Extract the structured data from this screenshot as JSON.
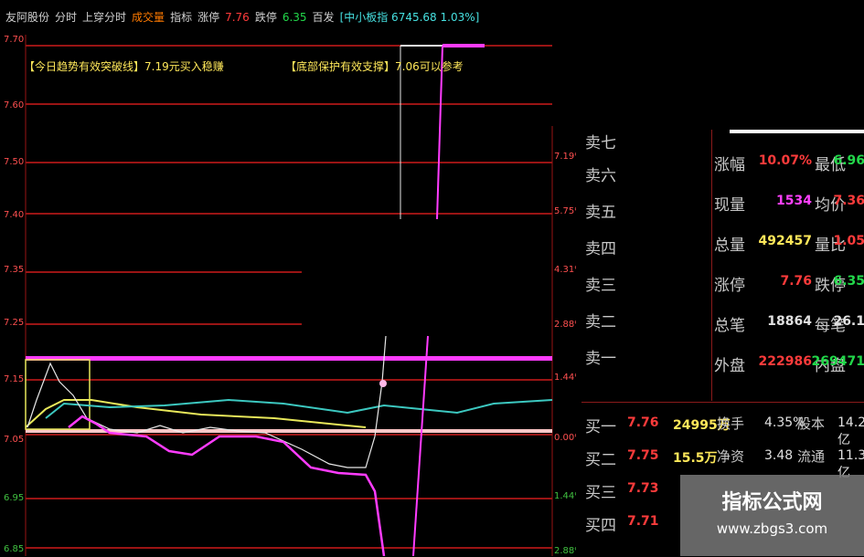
{
  "topbar": {
    "items": [
      {
        "text": "友阿股份",
        "color": "#d0d0d0"
      },
      {
        "text": "分时",
        "color": "#d0d0d0"
      },
      {
        "text": "上穿分时",
        "color": "#d0d0d0"
      },
      {
        "text": "成交量",
        "color": "#ff7a00"
      },
      {
        "text": "指标",
        "color": "#d0d0d0"
      },
      {
        "text": "涨停",
        "color": "#d0d0d0"
      },
      {
        "text": "7.76",
        "color": "#ff3b3b"
      },
      {
        "text": "跌停",
        "color": "#d0d0d0"
      },
      {
        "text": "6.35",
        "color": "#22d84a"
      },
      {
        "text": "百发",
        "color": "#d0d0d0"
      },
      {
        "text": "[中小板指 6745.68 1.03%]",
        "color": "#46e0e0"
      }
    ]
  },
  "chart": {
    "left_ticks": [
      "7.70",
      "7.60",
      "7.50",
      "7.40",
      "7.35",
      "7.25",
      "7.15",
      "7.05",
      "6.95",
      "6.85"
    ],
    "right_ticks": [
      "7.19%",
      "5.75%",
      "4.31%",
      "2.88%",
      "1.44%",
      "0.00%",
      "1.44%",
      "2.88%"
    ],
    "annotation_left": "【今日趋势有效突破线】7.19元买入稳赚",
    "annotation_right": "【底部保护有效支撑】7.06可以参考",
    "colors": {
      "grid": "#9a1414",
      "magenta": "#ff3cff",
      "yellow": "#e8e85a",
      "cyan": "#3cc8c0",
      "white": "#e8e8e8",
      "pink": "#ffc8c8"
    }
  },
  "quote_list": [
    "卖七",
    "卖六",
    "卖五",
    "卖四",
    "卖三",
    "卖二",
    "卖一"
  ],
  "stats": [
    {
      "l1": "涨幅",
      "v1": "10.07%",
      "c1": "#ff3b3b",
      "l2": "最低",
      "v2": "6.96",
      "c2": "#22d84a"
    },
    {
      "l1": "现量",
      "v1": "1534",
      "c1": "#ff40ff",
      "l2": "均价",
      "v2": "7.36",
      "c2": "#ff3b3b"
    },
    {
      "l1": "总量",
      "v1": "492457",
      "c1": "#ffe85a",
      "l2": "量比",
      "v2": "1.05",
      "c2": "#ff3b3b"
    },
    {
      "l1": "涨停",
      "v1": "7.76",
      "c1": "#ff3b3b",
      "l2": "跌停",
      "v2": "6.35",
      "c2": "#22d84a"
    },
    {
      "l1": "总笔",
      "v1": "18864",
      "c1": "#e0e0e0",
      "l2": "每笔",
      "v2": "26.1",
      "c2": "#e0e0e0"
    },
    {
      "l1": "外盘",
      "v1": "222986",
      "c1": "#ff3b3b",
      "l2": "内盘",
      "v2": "269471",
      "c2": "#22d84a"
    }
  ],
  "buy": [
    {
      "label": "买一",
      "price": "7.76",
      "vol": "24995万",
      "rl": "换手",
      "rv": "4.35%",
      "rl2": "股本",
      "rv2": "14.2亿"
    },
    {
      "label": "买二",
      "price": "7.75",
      "vol": "15.5万",
      "rl": "净资",
      "rv": "3.48",
      "rl2": "流通",
      "rv2": "11.3亿"
    },
    {
      "label": "买三",
      "price": "7.73",
      "vol": "",
      "rl": "",
      "rv": "",
      "rl2": "",
      "rv2": ""
    },
    {
      "label": "买四",
      "price": "7.71",
      "vol": "",
      "rl": "",
      "rv": "",
      "rl2": "",
      "rv2": ""
    }
  ],
  "watermark": {
    "title": "指标公式网",
    "url": "www.zbgs3.com"
  }
}
